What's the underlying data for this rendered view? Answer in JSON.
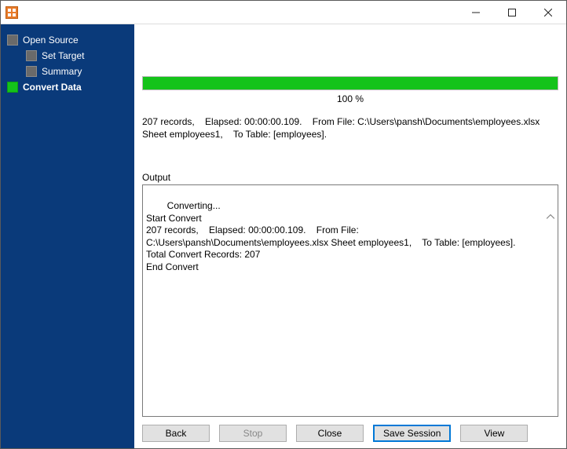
{
  "window": {
    "title": ""
  },
  "sidebar": {
    "items": [
      {
        "label": "Open Source",
        "active": false,
        "indent": 0
      },
      {
        "label": "Set Target",
        "active": false,
        "indent": 1
      },
      {
        "label": "Summary",
        "active": false,
        "indent": 1
      },
      {
        "label": "Convert Data",
        "active": true,
        "indent": 0
      }
    ]
  },
  "progress": {
    "percent": 100,
    "percent_label": "100 %"
  },
  "summary_text": "207 records,    Elapsed: 00:00:00.109.    From File: C:\\Users\\pansh\\Documents\\employees.xlsx Sheet employees1,    To Table: [employees].",
  "output": {
    "label": "Output",
    "text": "Converting...\nStart Convert\n207 records,    Elapsed: 00:00:00.109.    From File: C:\\Users\\pansh\\Documents\\employees.xlsx Sheet employees1,    To Table: [employees].\nTotal Convert Records: 207\nEnd Convert"
  },
  "buttons": {
    "back": "Back",
    "stop": "Stop",
    "close": "Close",
    "save_session": "Save Session",
    "view": "View"
  }
}
